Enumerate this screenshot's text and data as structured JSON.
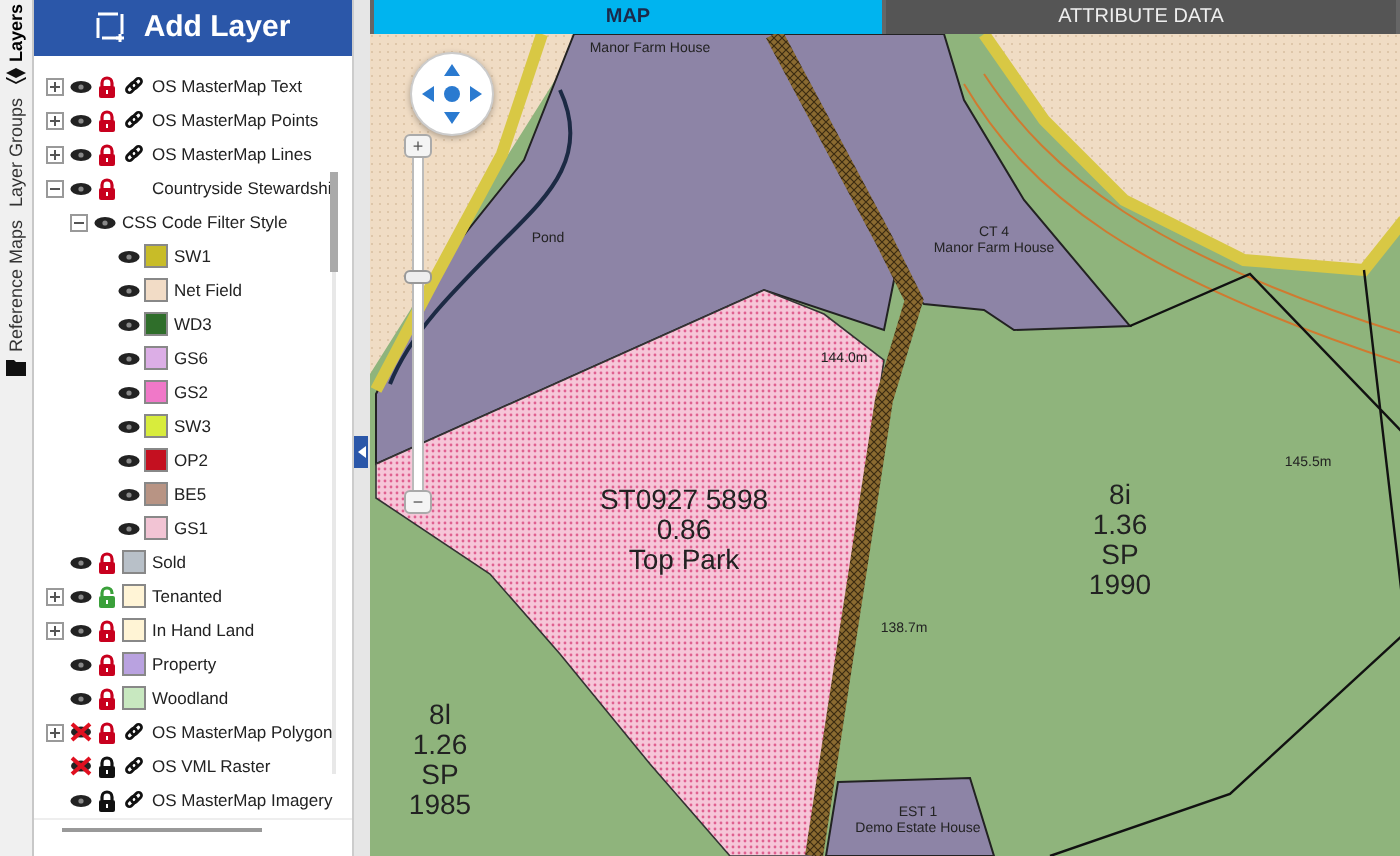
{
  "side_tabs": [
    {
      "label": "Layers",
      "selected": true
    },
    {
      "label": "Layer Groups",
      "selected": false
    },
    {
      "label": "Reference Maps",
      "selected": false
    }
  ],
  "add_layer_button": {
    "label": "Add Layer"
  },
  "layers": [
    {
      "label": "OS MasterMap Text",
      "visible": true,
      "expanded": false,
      "lock": {
        "locked": true,
        "color": "#c8001e"
      },
      "linked": true
    },
    {
      "label": "OS MasterMap Points",
      "visible": true,
      "expanded": false,
      "lock": {
        "locked": true,
        "color": "#c8001e"
      },
      "linked": true
    },
    {
      "label": "OS MasterMap Lines",
      "visible": true,
      "expanded": false,
      "lock": {
        "locked": true,
        "color": "#c8001e"
      },
      "linked": true
    },
    {
      "label": "Countryside Stewardshi",
      "visible": true,
      "expanded": true,
      "lock": {
        "locked": true,
        "color": "#c8001e"
      },
      "children": [
        {
          "label": "CSS Code Filter Style",
          "visible": true,
          "expanded": true,
          "children": [
            {
              "label": "SW1",
              "visible": true,
              "color": "#c8bc28"
            },
            {
              "label": "Net Field",
              "visible": true,
              "color": "#f2dcc6"
            },
            {
              "label": "WD3",
              "visible": true,
              "color": "#2f6e2a"
            },
            {
              "label": "GS6",
              "visible": true,
              "color": "#dcaee6"
            },
            {
              "label": "GS2",
              "visible": true,
              "color": "#f078c8"
            },
            {
              "label": "SW3",
              "visible": true,
              "color": "#d8ec3c"
            },
            {
              "label": "OP2",
              "visible": true,
              "color": "#c41020"
            },
            {
              "label": "BE5",
              "visible": true,
              "color": "#b89484"
            },
            {
              "label": "GS1",
              "visible": true,
              "color": "#f2c4d4"
            }
          ]
        }
      ]
    },
    {
      "label": "Sold",
      "visible": true,
      "lock": {
        "locked": true,
        "color": "#c8001e"
      },
      "color": "#b8c0c8"
    },
    {
      "label": "Tenanted",
      "visible": true,
      "expanded": false,
      "lock": {
        "locked": false,
        "color": "#3aa03a"
      },
      "color": "#fff4d6"
    },
    {
      "label": "In Hand Land",
      "visible": true,
      "expanded": false,
      "lock": {
        "locked": true,
        "color": "#c8001e"
      },
      "color": "#fff4d5"
    },
    {
      "label": "Property",
      "visible": true,
      "lock": {
        "locked": true,
        "color": "#c8001e"
      },
      "color": "#b9a2e0"
    },
    {
      "label": "Woodland",
      "visible": true,
      "lock": {
        "locked": true,
        "color": "#c8001e"
      },
      "color": "#c8e8c0"
    },
    {
      "label": "OS MasterMap Polygon",
      "visible": false,
      "expanded": false,
      "lock": {
        "locked": true,
        "color": "#c8001e"
      },
      "linked": true
    },
    {
      "label": "OS VML Raster",
      "visible": false,
      "lock": {
        "locked": true,
        "color": "#111111"
      },
      "linked": true
    },
    {
      "label": "OS MasterMap Imagery",
      "visible": true,
      "lock": {
        "locked": true,
        "color": "#111111"
      },
      "linked": true
    }
  ],
  "view_tabs": [
    {
      "label": "MAP",
      "selected": true
    },
    {
      "label": "ATTRIBUTE DATA",
      "selected": false
    }
  ],
  "zoom": {
    "plus": "+",
    "minus": "−",
    "level": 0.69
  },
  "map_labels": [
    {
      "kind": "small",
      "lines": [
        "Manor Farm House"
      ]
    },
    {
      "kind": "small",
      "lines": [
        "Pond"
      ]
    },
    {
      "kind": "small",
      "lines": [
        "CT 4",
        "Manor Farm House"
      ]
    },
    {
      "kind": "small",
      "lines": [
        "144.0m"
      ]
    },
    {
      "kind": "large",
      "lines": [
        "ST0927 5898",
        "0.86",
        "Top Park"
      ]
    },
    {
      "kind": "large",
      "lines": [
        "8i",
        "1.36",
        "SP",
        "1990"
      ]
    },
    {
      "kind": "small",
      "lines": [
        "145.5m"
      ]
    },
    {
      "kind": "small",
      "lines": [
        "138.7m"
      ]
    },
    {
      "kind": "large",
      "lines": [
        "8l",
        "1.26",
        "SP",
        "1985"
      ]
    },
    {
      "kind": "small",
      "lines": [
        "EST 1",
        "Demo Estate House"
      ]
    }
  ]
}
